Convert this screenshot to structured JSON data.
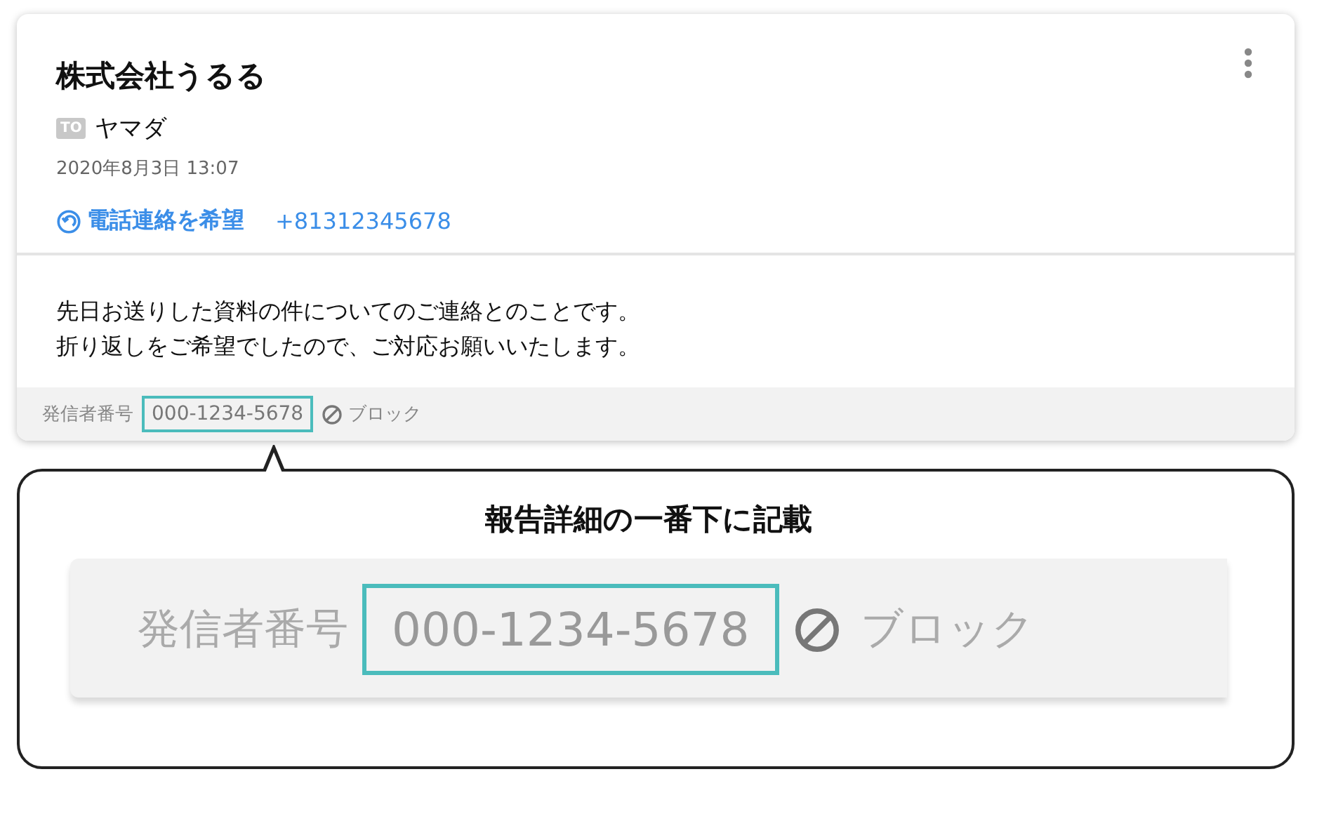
{
  "card": {
    "title": "株式会社うるる",
    "to_badge": "TO",
    "recipient": "ヤマダ",
    "datetime": "2020年8月3日 13:07",
    "callback": {
      "label": "電話連絡を希望",
      "phone": "+81312345678"
    },
    "message_lines": [
      "先日お送りした資料の件についてのご連絡とのことです。",
      "折り返しをご希望でしたので、ご対応お願いいたします。"
    ],
    "footer": {
      "label": "発信者番号",
      "number": "000-1234-5678",
      "highlighted": true,
      "block": "ブロック"
    }
  },
  "callout": {
    "title": "報告詳細の一番下に記載",
    "zoom": {
      "label": "発信者番号",
      "number": "000-1234-5678",
      "highlighted": true,
      "block": "ブロック"
    }
  }
}
